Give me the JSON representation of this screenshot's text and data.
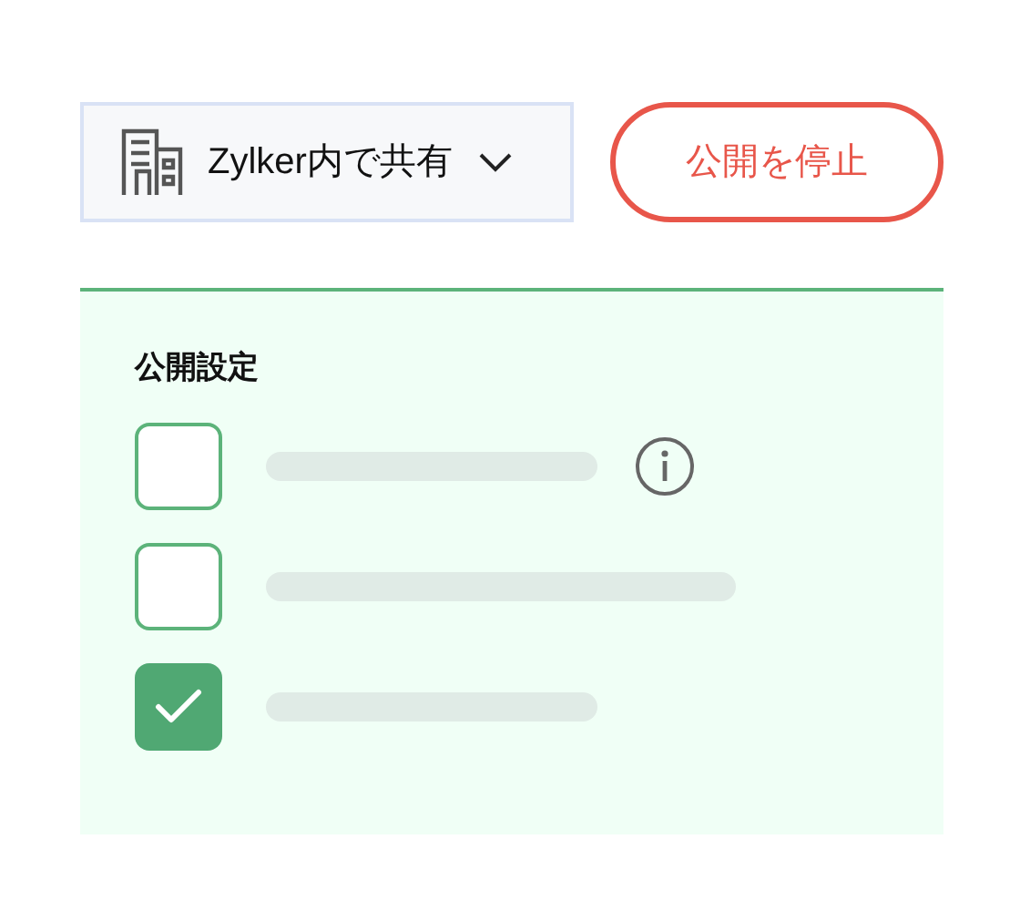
{
  "share_dropdown": {
    "label": "Zylker内で共有"
  },
  "stop_button": {
    "label": "公開を停止"
  },
  "settings_panel": {
    "title": "公開設定",
    "options": [
      {
        "checked": false,
        "info": true
      },
      {
        "checked": false,
        "info": false
      },
      {
        "checked": true,
        "info": false
      }
    ]
  }
}
